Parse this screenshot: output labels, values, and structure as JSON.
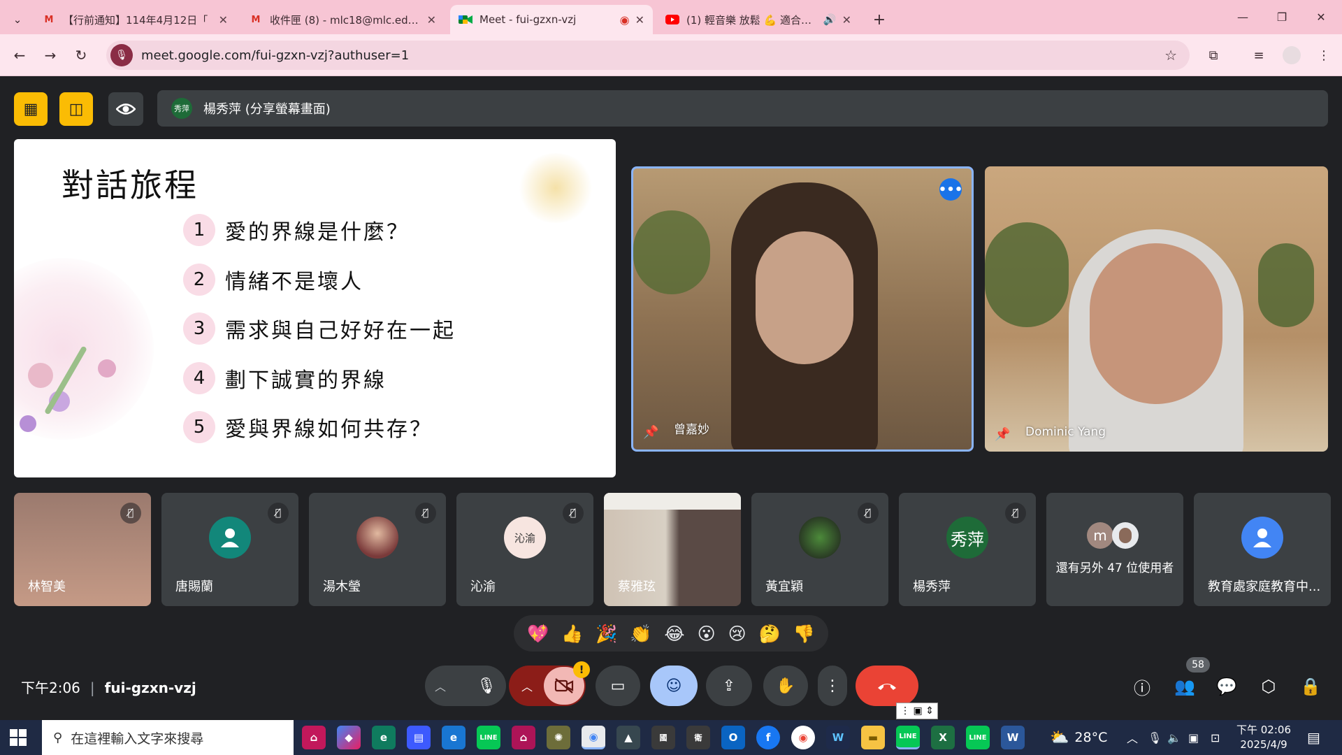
{
  "browser": {
    "tabs": [
      {
        "title": "【行前通知】114年4月12日「",
        "favicon": "gmail-icon"
      },
      {
        "title": "收件匣 (8) - mlc18@mlc.edu.tw",
        "favicon": "gmail-icon"
      },
      {
        "title": "Meet - fui-gzxn-vzj",
        "favicon": "meet-icon",
        "active": true
      },
      {
        "title": "(1) 輕音樂 放鬆 💪 適合早上",
        "favicon": "youtube-icon"
      }
    ],
    "url": "meet.google.com/fui-gzxn-vzj?authuser=1"
  },
  "meet": {
    "presenter_avatar": "秀萍",
    "presenting_label": "楊秀萍 (分享螢幕畫面)",
    "slide": {
      "title": "對話旅程",
      "items": [
        {
          "num": "1",
          "text": "愛的界線是什麼？"
        },
        {
          "num": "2",
          "text": "情緒不是壞人"
        },
        {
          "num": "3",
          "text": "需求與自己好好在一起"
        },
        {
          "num": "4",
          "text": "劃下誠實的界線"
        },
        {
          "num": "5",
          "text": "愛與界線如何共存？"
        }
      ]
    },
    "pinned": [
      {
        "name": "曾嘉妙"
      },
      {
        "name": "Dominic Yang"
      }
    ],
    "participants": [
      {
        "name": "林智美",
        "avatar": ""
      },
      {
        "name": "唐賜蘭",
        "avatar": "person-icon"
      },
      {
        "name": "湯木瑩",
        "avatar": "photo"
      },
      {
        "name": "沁渝",
        "avatar": "沁渝"
      },
      {
        "name": "蔡雅玹",
        "avatar": ""
      },
      {
        "name": "黃宜穎",
        "avatar": "photo"
      },
      {
        "name": "楊秀萍",
        "avatar": "秀萍"
      },
      {
        "name": "還有另外 47 位使用者",
        "avatar": "m"
      },
      {
        "name": "教育處家庭教育中...",
        "avatar": "person-icon"
      }
    ],
    "reactions": [
      "💖",
      "👍",
      "🎉",
      "👏",
      "😂",
      "😮",
      "😢",
      "🤔",
      "👎"
    ],
    "time": "下午2:06",
    "meeting_code": "fui-gzxn-vzj",
    "people_count": "58",
    "camera_warning": "!"
  },
  "taskbar": {
    "search_placeholder": "在這裡輸入文字來搜尋",
    "weather": "28°C",
    "clock_time": "下午 02:06",
    "clock_date": "2025/4/9"
  },
  "colors": {
    "tabstrip": "#f7c5d4",
    "toolbar": "#fde6ee",
    "meet_bg": "#202124",
    "end_call": "#ea4335",
    "active_blue": "#8ab4f8"
  }
}
